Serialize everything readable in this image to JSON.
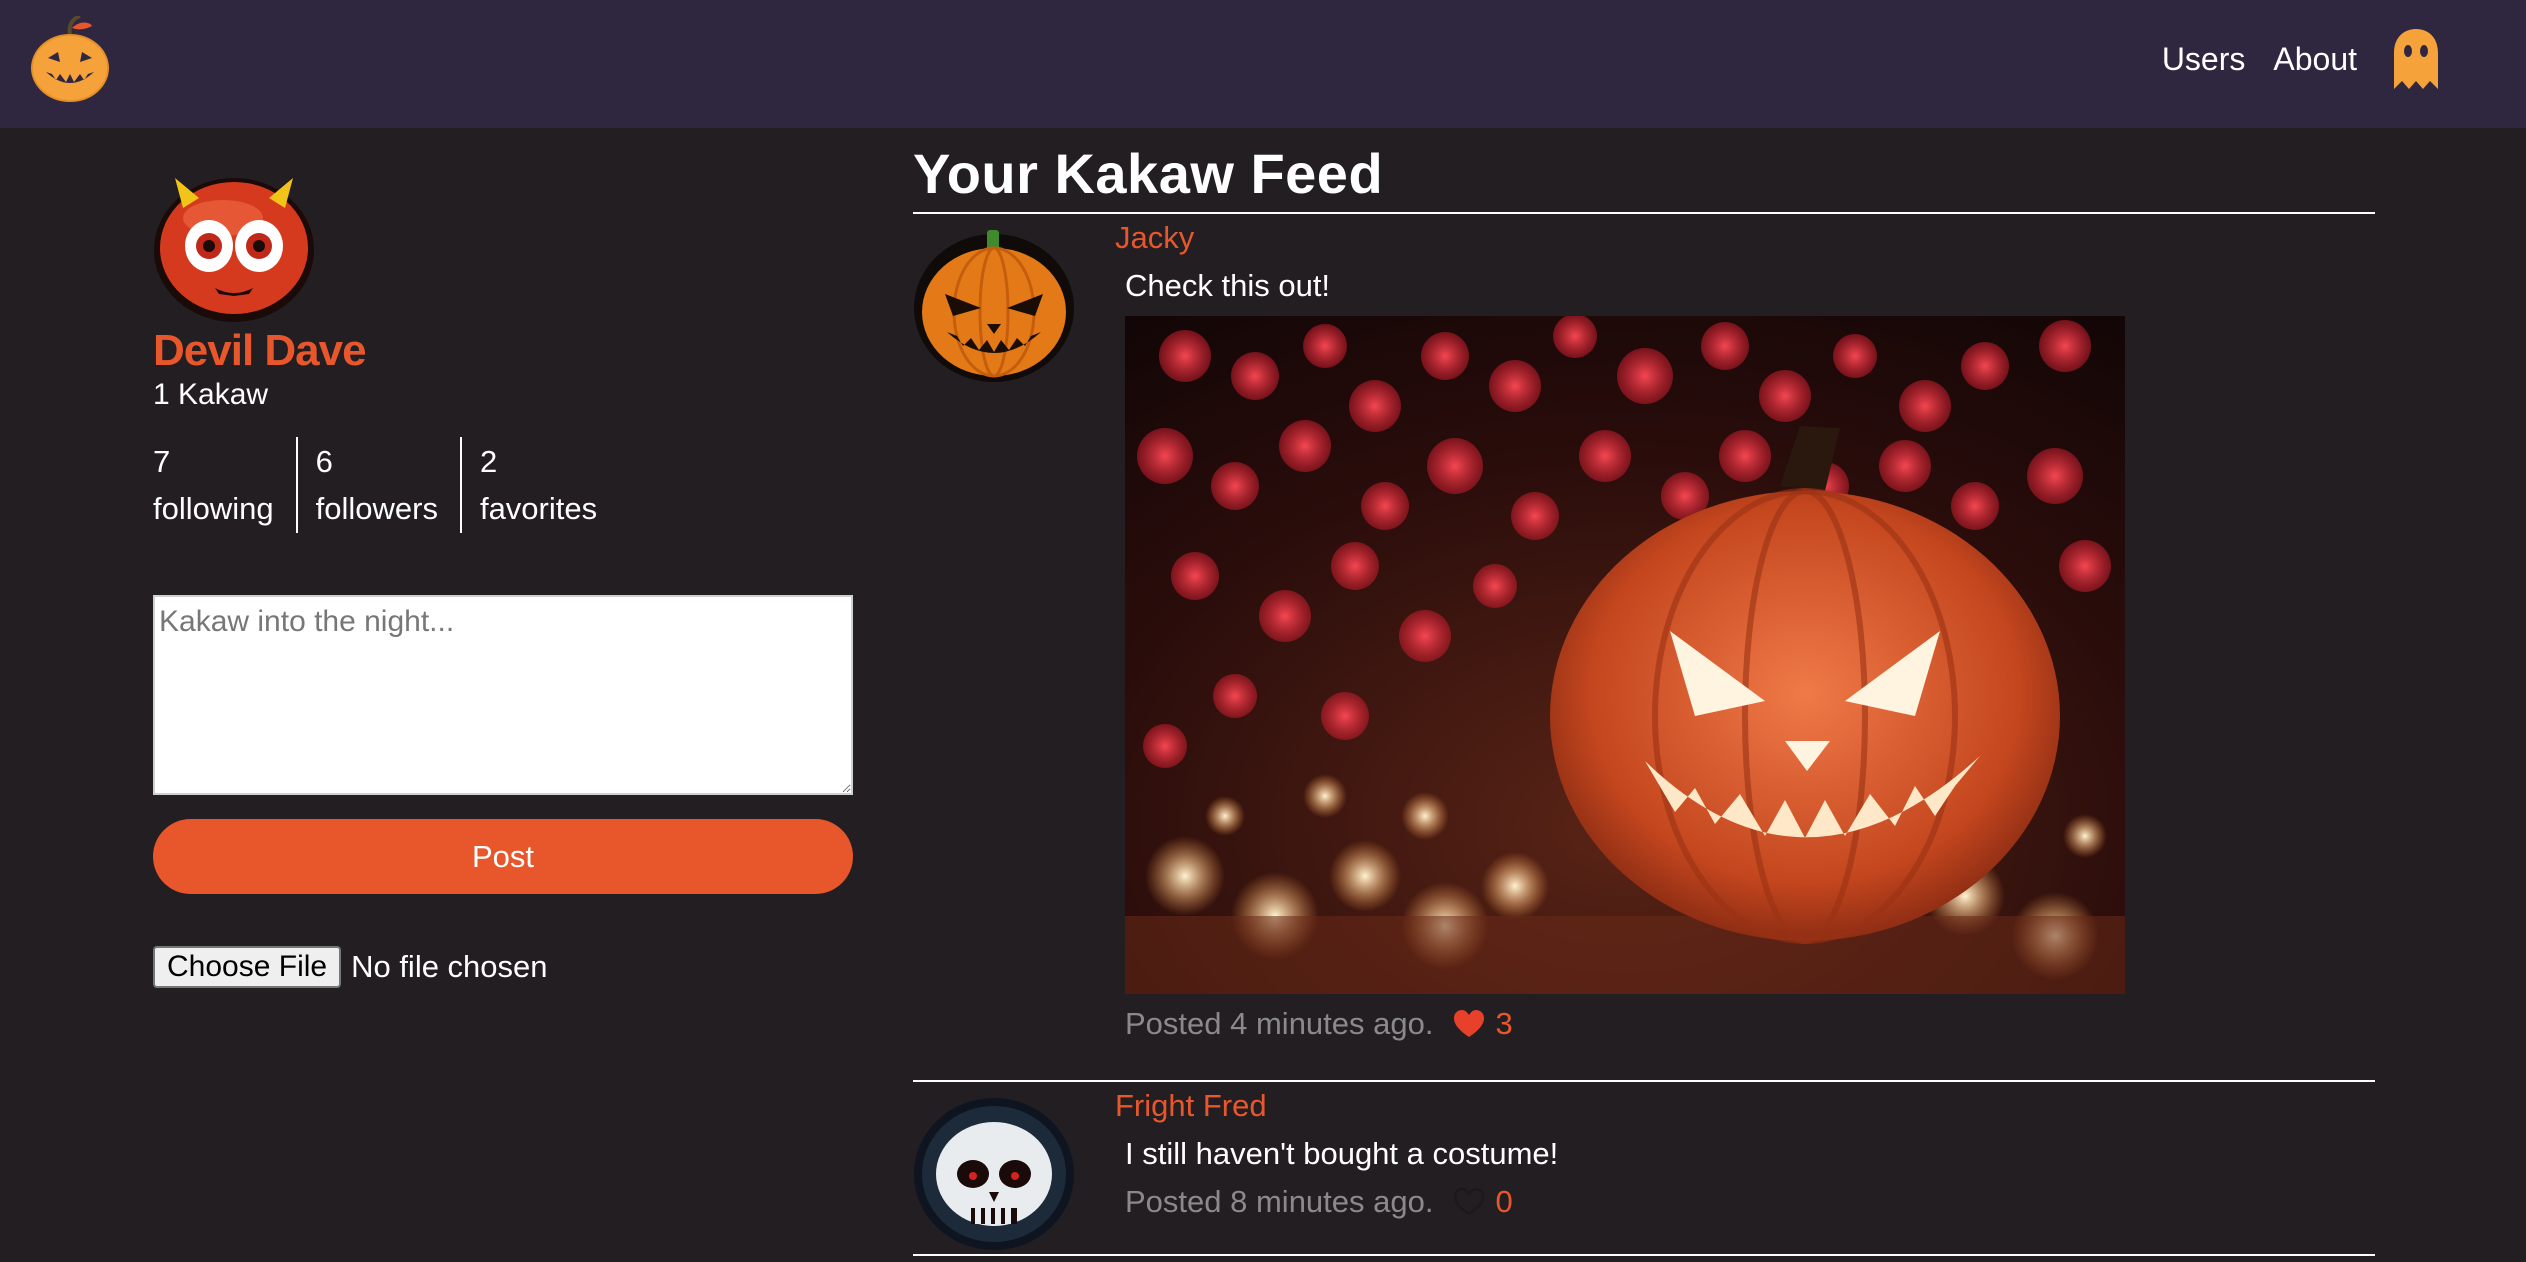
{
  "nav": {
    "links": [
      "Users",
      "About"
    ],
    "logo_icon": "pumpkin-logo-icon",
    "user_icon": "ghost-icon"
  },
  "profile": {
    "name": "Devil Dave",
    "kakaw_count": "1 Kakaw",
    "avatar_icon": "devil-avatar-icon",
    "stats": [
      {
        "value": "7",
        "label": "following"
      },
      {
        "value": "6",
        "label": "followers"
      },
      {
        "value": "2",
        "label": "favorites"
      }
    ]
  },
  "composer": {
    "placeholder": "Kakaw into the night...",
    "post_label": "Post",
    "file_button_label": "Choose File",
    "file_status": "No file chosen"
  },
  "feed": {
    "title": "Your Kakaw Feed",
    "items": [
      {
        "author": "Jacky",
        "avatar_icon": "jack-o-lantern-avatar-icon",
        "text": "Check this out!",
        "has_image": true,
        "image_desc_icon": "jack-o-lantern-photo",
        "posted": "Posted 4 minutes ago.",
        "liked": true,
        "likes": "3"
      },
      {
        "author": "Fright Fred",
        "avatar_icon": "skull-avatar-icon",
        "text": "I still haven't bought a costume!",
        "has_image": false,
        "posted": "Posted 8 minutes ago.",
        "liked": false,
        "likes": "0"
      }
    ]
  },
  "colors": {
    "background": "#221e22",
    "navbar": "#2f2640",
    "accent": "#e8572b",
    "muted": "#8a8a8a"
  }
}
